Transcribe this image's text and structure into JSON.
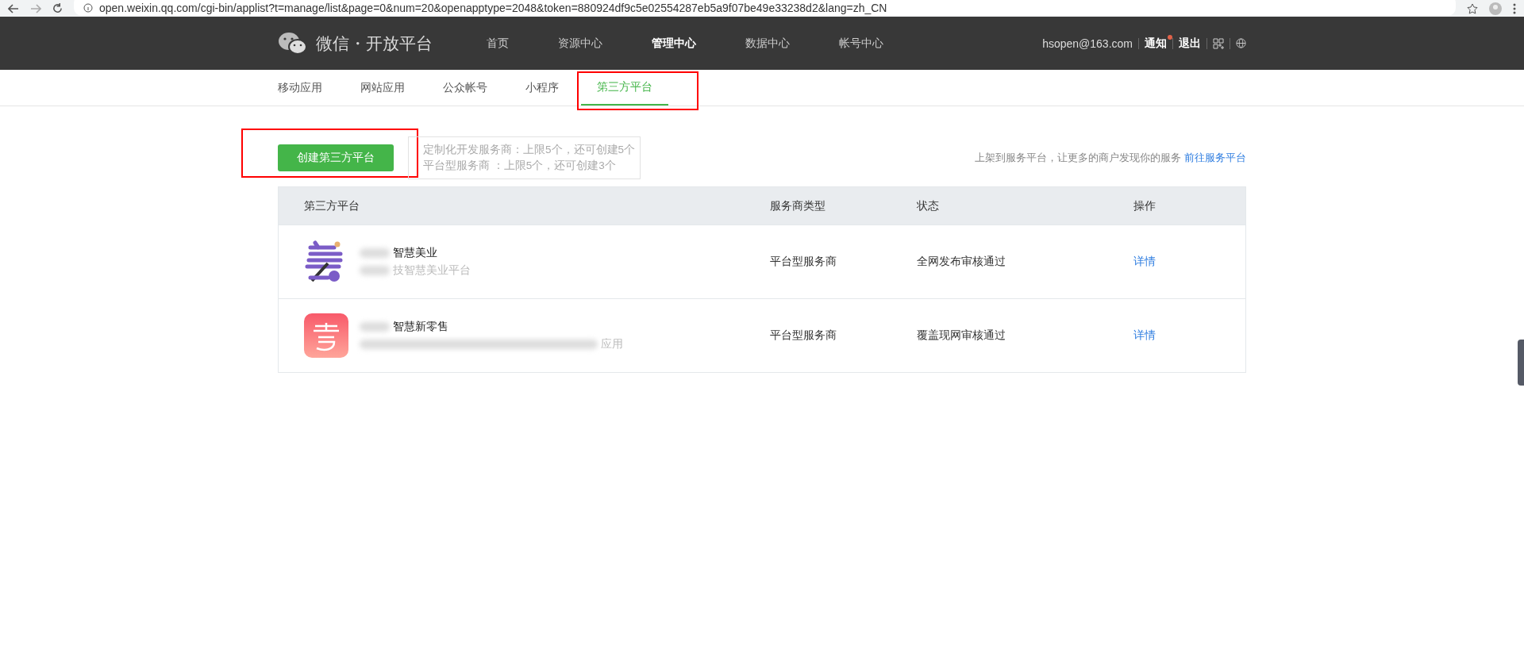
{
  "browser": {
    "url": "open.weixin.qq.com/cgi-bin/applist?t=manage/list&page=0&num=20&openapptype=2048&token=880924df9c5e02554287eb5a9f07be49e33238d2&lang=zh_CN"
  },
  "header": {
    "logo": "微信・开放平台",
    "nav": [
      {
        "label": "首页",
        "selected": false
      },
      {
        "label": "资源中心",
        "selected": false
      },
      {
        "label": "管理中心",
        "selected": true
      },
      {
        "label": "数据中心",
        "selected": false
      },
      {
        "label": "帐号中心",
        "selected": false
      }
    ],
    "account": "hsopen@163.com",
    "notice": "通知",
    "notice_unread": true,
    "logout": "退出"
  },
  "subnav": [
    {
      "label": "移动应用",
      "selected": false
    },
    {
      "label": "网站应用",
      "selected": false
    },
    {
      "label": "公众帐号",
      "selected": false
    },
    {
      "label": "小程序",
      "selected": false
    },
    {
      "label": "第三方平台",
      "selected": true
    }
  ],
  "create_button": "创建第三方平台",
  "quota_tip": [
    "定制化开发服务商：上限5个，还可创建5个",
    "平台型服务商 ：上限5个，还可创建3个"
  ],
  "promo": {
    "text": "上架到服务平台，让更多的商户发现你的服务",
    "link": "前往服务平台"
  },
  "table": {
    "columns": [
      "第三方平台",
      "服务商类型",
      "状态",
      "操作"
    ],
    "rows": [
      {
        "name": "智慧美业",
        "desc": "技智慧美业平台",
        "type": "平台型服务商",
        "status": "全网发布审核通过",
        "action": "详情"
      },
      {
        "name": "智慧新零售",
        "desc": "应用",
        "type": "平台型服务商",
        "status": "覆盖现网审核通过",
        "action": "详情"
      }
    ]
  }
}
